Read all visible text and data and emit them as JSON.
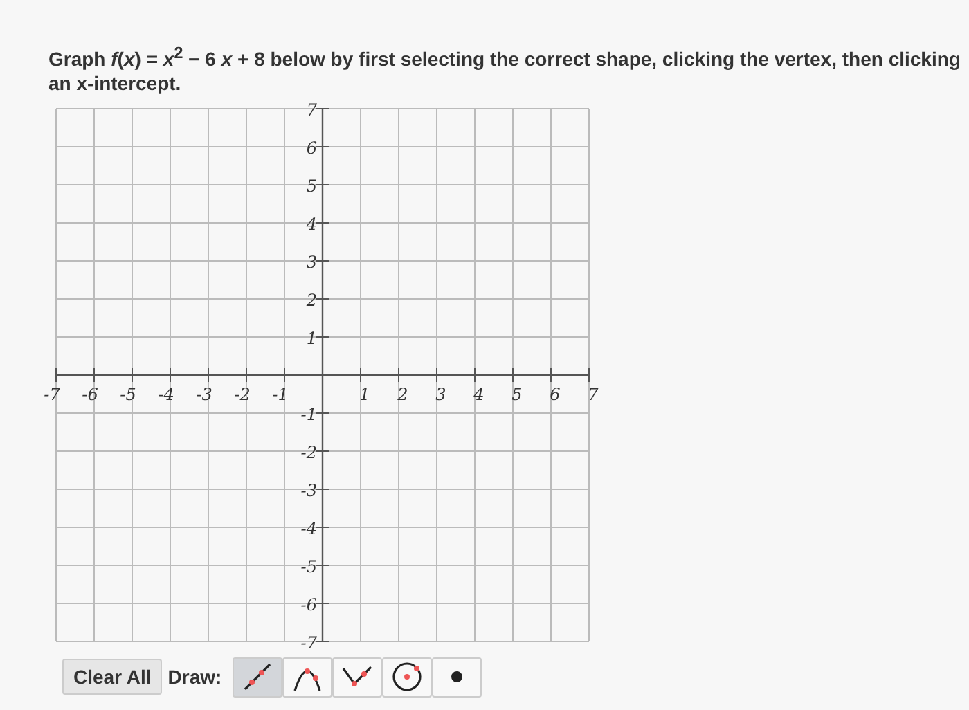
{
  "question": "Graph *f*(*x*) = *x*$^{2}$ − 6 *x* + 8 below by first selecting the correct shape, clicking the vertex, then clicking an x-intercept.",
  "graph": {
    "x_labels": [
      "-7",
      "-6",
      "-5",
      "-4",
      "-3",
      "-2",
      "-1",
      "1",
      "2",
      "3",
      "4",
      "5",
      "6",
      "7"
    ],
    "y_labels": [
      "7",
      "6",
      "5",
      "4",
      "3",
      "2",
      "1",
      "-1",
      "-2",
      "-3",
      "-4",
      "-5",
      "-6",
      "-7"
    ]
  },
  "clear_button": "Clear All",
  "draw_label": "Draw:",
  "tools": [
    {
      "kind": "line",
      "selected": true
    },
    {
      "kind": "parabola",
      "selected": false
    },
    {
      "kind": "absolute",
      "selected": false
    },
    {
      "kind": "circle",
      "selected": false
    },
    {
      "kind": "point",
      "selected": false
    }
  ]
}
